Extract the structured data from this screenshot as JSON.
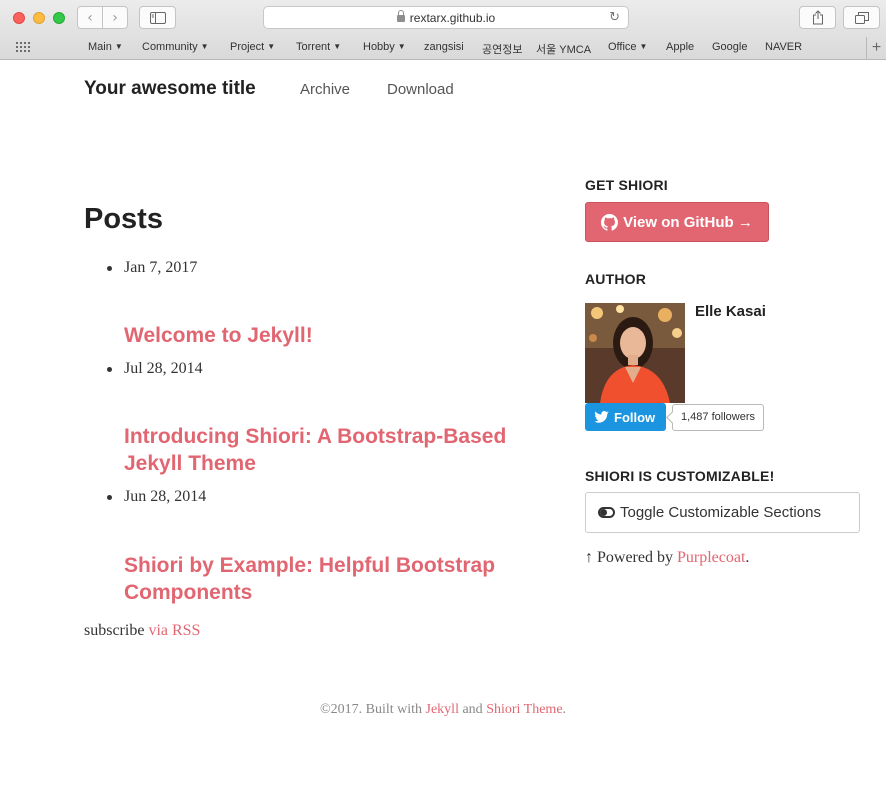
{
  "browser": {
    "url": "rextarx.github.io",
    "bookmarks": [
      {
        "label": "Main",
        "dropdown": true
      },
      {
        "label": "Community",
        "dropdown": true
      },
      {
        "label": "Project",
        "dropdown": true
      },
      {
        "label": "Torrent",
        "dropdown": true
      },
      {
        "label": "Hobby",
        "dropdown": true
      },
      {
        "label": "zangsisi",
        "dropdown": false
      },
      {
        "label": "공연정보",
        "dropdown": false
      },
      {
        "label": "서울 YMCA",
        "dropdown": false
      },
      {
        "label": "Office",
        "dropdown": true
      },
      {
        "label": "Apple",
        "dropdown": false
      },
      {
        "label": "Google",
        "dropdown": false
      },
      {
        "label": "NAVER",
        "dropdown": false
      }
    ]
  },
  "header": {
    "site_title": "Your awesome title",
    "nav": [
      "Archive",
      "Download"
    ]
  },
  "posts": {
    "heading": "Posts",
    "items": [
      {
        "date": "Jan 7, 2017",
        "title": "Welcome to Jekyll!"
      },
      {
        "date": "Jul 28, 2014",
        "title": "Introducing Shiori: A Bootstrap-Based Jekyll Theme"
      },
      {
        "date": "Jun 28, 2014",
        "title": "Shiori by Example: Helpful Bootstrap Components"
      }
    ],
    "subscribe_prefix": "subscribe",
    "subscribe_link": "via RSS"
  },
  "sidebar": {
    "get_heading": "GET SHIORI",
    "github_button": "View on GitHub →",
    "author_heading": "AUTHOR",
    "author_name": "Elle Kasai",
    "follow_label": "Follow",
    "followers": "1,487 followers",
    "custom_heading": "SHIORI IS CUSTOMIZABLE!",
    "toggle_button": "Toggle Customizable Sections",
    "powered_prefix": "↑ Powered by",
    "powered_link": "Purplecoat",
    "powered_suffix": "."
  },
  "footer": {
    "prefix": "©2017. Built with",
    "link1": "Jekyll",
    "middle": "and",
    "link2": "Shiori Theme",
    "suffix": "."
  },
  "colors": {
    "accent": "#e16671",
    "twitter": "#1b95e0"
  }
}
